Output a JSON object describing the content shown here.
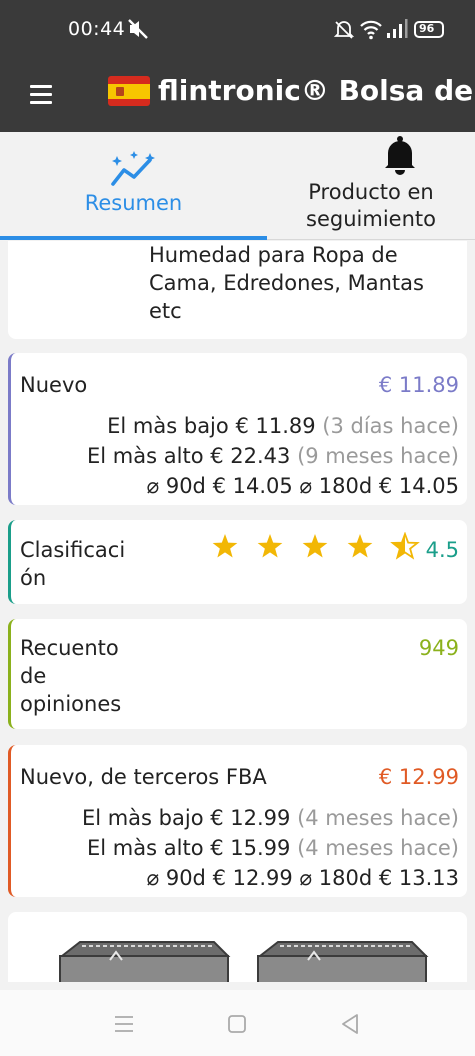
{
  "status_bar": {
    "time": "00:44",
    "battery": "96",
    "icons": [
      "mute-icon",
      "alarm-off-icon",
      "wifi-icon",
      "signal-icon",
      "battery-icon"
    ]
  },
  "app_bar": {
    "title": "flintronic® Bolsa de Alm",
    "flag": "spain-flag",
    "menu_icon": "hamburger-menu-icon"
  },
  "tabs": [
    {
      "label": "Resumen",
      "icon": "trend-sparkle-icon",
      "active": true
    },
    {
      "label_line1": "Producto en",
      "label_line2": "seguimiento",
      "icon": "bell-icon",
      "active": false
    }
  ],
  "title_card": {
    "line1": "Humedad para Ropa de",
    "line2": "Cama, Edredones, Mantas",
    "line3": "etc"
  },
  "nuevo_card": {
    "label": "Nuevo",
    "price": "€ 11.89",
    "accent_color": "#7b7bc8",
    "lowest_label": "El màs bajo",
    "lowest_value": "€ 11.89",
    "lowest_when": "(3 días hace)",
    "highest_label": "El màs alto",
    "highest_value": "€ 22.43",
    "highest_when": "(9 meses hace)",
    "avg90_label": "⌀ 90d",
    "avg90_value": "€ 14.05",
    "avg180_label": "⌀ 180d",
    "avg180_value": "€ 14.05"
  },
  "rating_card": {
    "label_line1": "Clasificaci",
    "label_line2": "ón",
    "stars": 4.5,
    "value": "4.5",
    "accent_color": "#1a9e8a",
    "star_color": "#f2b705"
  },
  "reviews_card": {
    "label_line1": "Recuento",
    "label_line2": "de",
    "label_line3": "opiniones",
    "value": "949",
    "accent_color": "#8bb11c"
  },
  "fba_card": {
    "label": "Nuevo, de terceros FBA",
    "price": "€ 12.99",
    "accent_color": "#e05a25",
    "lowest_label": "El màs bajo",
    "lowest_value": "€ 12.99",
    "lowest_when": "(4 meses hace)",
    "highest_label": "El màs alto",
    "highest_value": "€ 15.99",
    "highest_when": "(4 meses hace)",
    "avg90_label": "⌀ 90d",
    "avg90_value": "€ 12.99",
    "avg180_label": "⌀ 180d",
    "avg180_value": "€ 13.13"
  },
  "image_card": {
    "images": [
      "storage-bag-image",
      "storage-bag-image"
    ]
  },
  "nav_bar": {
    "icons": [
      "recents-icon",
      "home-icon",
      "back-icon"
    ]
  }
}
